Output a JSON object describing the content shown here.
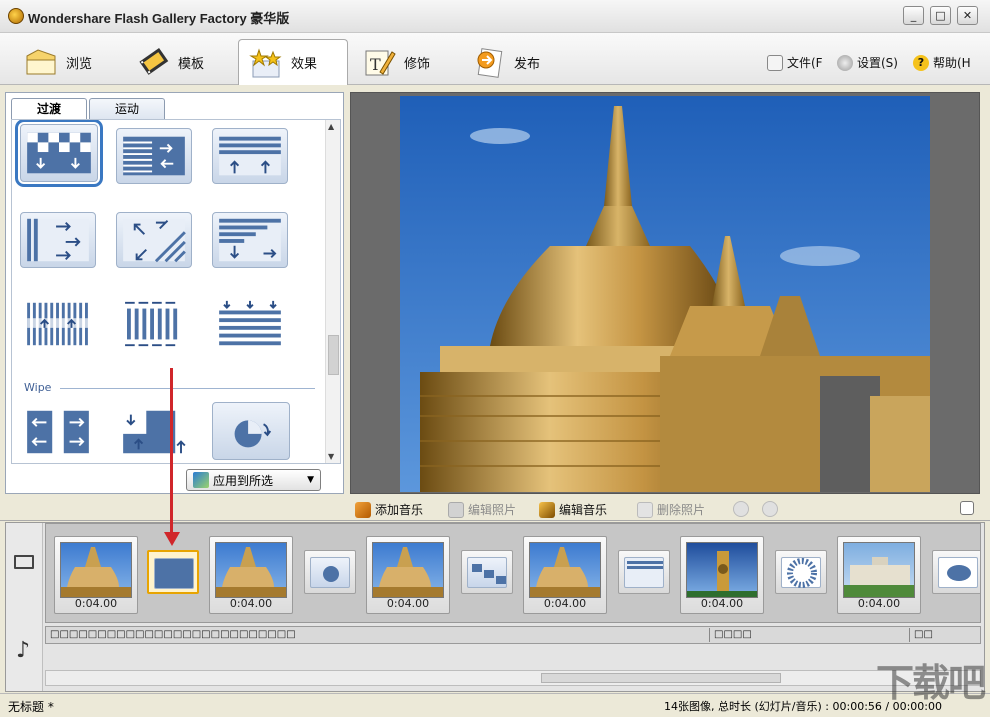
{
  "window": {
    "title": "Wondershare Flash Gallery Factory 豪华版",
    "controls": [
      "_",
      "□",
      "✕"
    ]
  },
  "tabs": [
    {
      "label": "浏览",
      "icon": "folder-icon"
    },
    {
      "label": "模板",
      "icon": "film-icon"
    },
    {
      "label": "效果",
      "icon": "stars-icon",
      "active": true
    },
    {
      "label": "修饰",
      "icon": "edit-icon"
    },
    {
      "label": "发布",
      "icon": "publish-icon"
    }
  ],
  "menus": {
    "file": "文件(F",
    "settings": "设置(S)",
    "help": "帮助(H"
  },
  "effects_panel": {
    "subtabs": [
      "过渡",
      "运动"
    ],
    "section_label": "Wipe",
    "apply_button": "应用到所选"
  },
  "midbar": {
    "add_music": "添加音乐",
    "edit_photo": "编辑照片",
    "edit_music": "编辑音乐",
    "delete_photo": "删除照片"
  },
  "timeline": {
    "durations": [
      "0:04.00",
      "0:04.00",
      "0:04.00",
      "0:04.00",
      "0:04.00",
      "0:04.00"
    ],
    "audio_segments": [
      "□□□□□□□□□□□□□□□□□□□□□□□□□□",
      "□□□□",
      "□□"
    ]
  },
  "status": {
    "left": "无标题 *",
    "right": "14张图像, 总时长 (幻灯片/音乐) : 00:00:56 / 00:00:00"
  },
  "watermark": "下载吧"
}
